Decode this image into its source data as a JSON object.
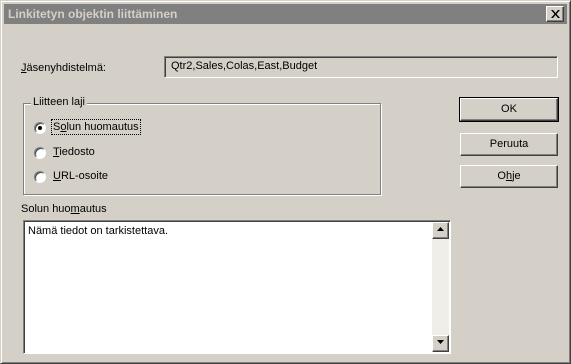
{
  "window": {
    "title": "Linkitetyn objektin liittäminen",
    "close_icon": "close-icon"
  },
  "member": {
    "label_prefix": "",
    "label_mnemonic": "J",
    "label_rest": "äsenyhdistelmä:",
    "value": "Qtr2,Sales,Colas,East,Budget"
  },
  "attachment_type": {
    "legend": "Liitteen laji",
    "selected": "cell_note",
    "options": [
      {
        "id": "cell_note",
        "pre": "S",
        "mnemonic": "o",
        "post": "lun huomautus",
        "checked": true
      },
      {
        "id": "file",
        "pre": "",
        "mnemonic": "T",
        "post": "iedosto",
        "checked": false
      },
      {
        "id": "url",
        "pre": "",
        "mnemonic": "U",
        "post": "RL-osoite",
        "checked": false
      }
    ]
  },
  "buttons": {
    "ok": {
      "label": "OK"
    },
    "cancel": {
      "label": "Peruuta"
    },
    "help": {
      "pre": "O",
      "mnemonic": "h",
      "post": "je"
    }
  },
  "note": {
    "label_pre": "Solun huo",
    "label_mnemonic": "m",
    "label_post": "autus",
    "text": "Nämä tiedot on tarkistettava."
  },
  "colors": {
    "face": "#d4d0c8",
    "titlebar_inactive": "#808080"
  }
}
